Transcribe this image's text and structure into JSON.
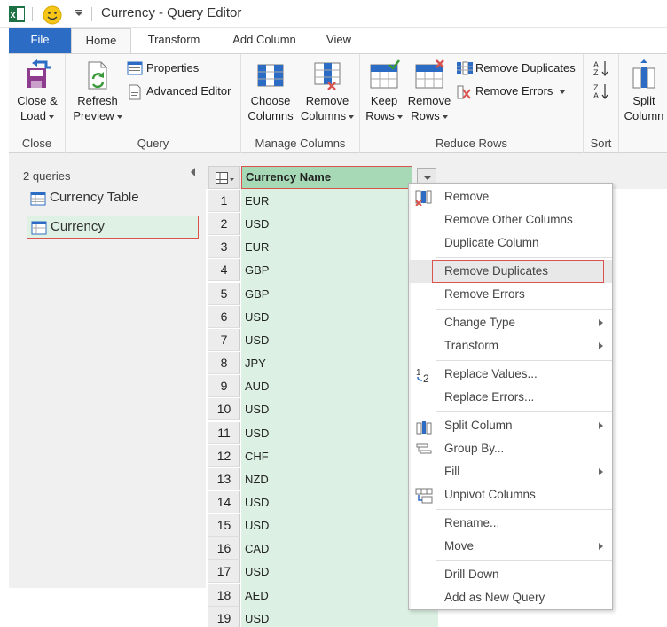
{
  "window": {
    "title": "Currency - Query Editor"
  },
  "tabs": [
    {
      "label": "File"
    },
    {
      "label": "Home"
    },
    {
      "label": "Transform"
    },
    {
      "label": "Add Column"
    },
    {
      "label": "View"
    }
  ],
  "ribbon": {
    "close": {
      "btn_line1": "Close &",
      "btn_line2": "Load",
      "group": "Close"
    },
    "query": {
      "refresh_line1": "Refresh",
      "refresh_line2": "Preview",
      "properties": "Properties",
      "advanced_editor": "Advanced Editor",
      "group": "Query"
    },
    "manage_columns": {
      "choose_line1": "Choose",
      "choose_line2": "Columns",
      "remove_line1": "Remove",
      "remove_line2": "Columns",
      "group": "Manage Columns"
    },
    "reduce_rows": {
      "keep_line1": "Keep",
      "keep_line2": "Rows",
      "remove_line1": "Remove",
      "remove_line2": "Rows",
      "remove_duplicates": "Remove Duplicates",
      "remove_errors": "Remove Errors",
      "group": "Reduce Rows"
    },
    "sort": {
      "group": "Sort"
    },
    "split": {
      "line1": "Split",
      "line2": "Column"
    }
  },
  "queries": {
    "count": "2 queries",
    "items": [
      {
        "label": "Currency Table"
      },
      {
        "label": "Currency"
      }
    ]
  },
  "grid": {
    "column_header": "Currency Name",
    "rows": [
      {
        "n": "1",
        "v": "EUR"
      },
      {
        "n": "2",
        "v": "USD"
      },
      {
        "n": "3",
        "v": "EUR"
      },
      {
        "n": "4",
        "v": "GBP"
      },
      {
        "n": "5",
        "v": "GBP"
      },
      {
        "n": "6",
        "v": "USD"
      },
      {
        "n": "7",
        "v": "USD"
      },
      {
        "n": "8",
        "v": "JPY"
      },
      {
        "n": "9",
        "v": "AUD"
      },
      {
        "n": "10",
        "v": "USD"
      },
      {
        "n": "11",
        "v": "USD"
      },
      {
        "n": "12",
        "v": "CHF"
      },
      {
        "n": "13",
        "v": "NZD"
      },
      {
        "n": "14",
        "v": "USD"
      },
      {
        "n": "15",
        "v": "USD"
      },
      {
        "n": "16",
        "v": "CAD"
      },
      {
        "n": "17",
        "v": "USD"
      },
      {
        "n": "18",
        "v": "AED"
      },
      {
        "n": "19",
        "v": "USD"
      }
    ]
  },
  "context_menu": {
    "remove": "Remove",
    "remove_other_columns": "Remove Other Columns",
    "duplicate_column": "Duplicate Column",
    "remove_duplicates": "Remove Duplicates",
    "remove_errors": "Remove Errors",
    "change_type": "Change Type",
    "transform": "Transform",
    "replace_values": "Replace Values...",
    "replace_errors": "Replace Errors...",
    "split_column": "Split Column",
    "group_by": "Group By...",
    "fill": "Fill",
    "unpivot_columns": "Unpivot Columns",
    "rename": "Rename...",
    "move": "Move",
    "drill_down": "Drill Down",
    "add_as_new_query": "Add as New Query"
  },
  "colors": {
    "accent": "#2c6cc4",
    "highlight_border": "#d9534f",
    "column_fill": "#dcf1e3",
    "header_fill": "#a8d9b6"
  }
}
